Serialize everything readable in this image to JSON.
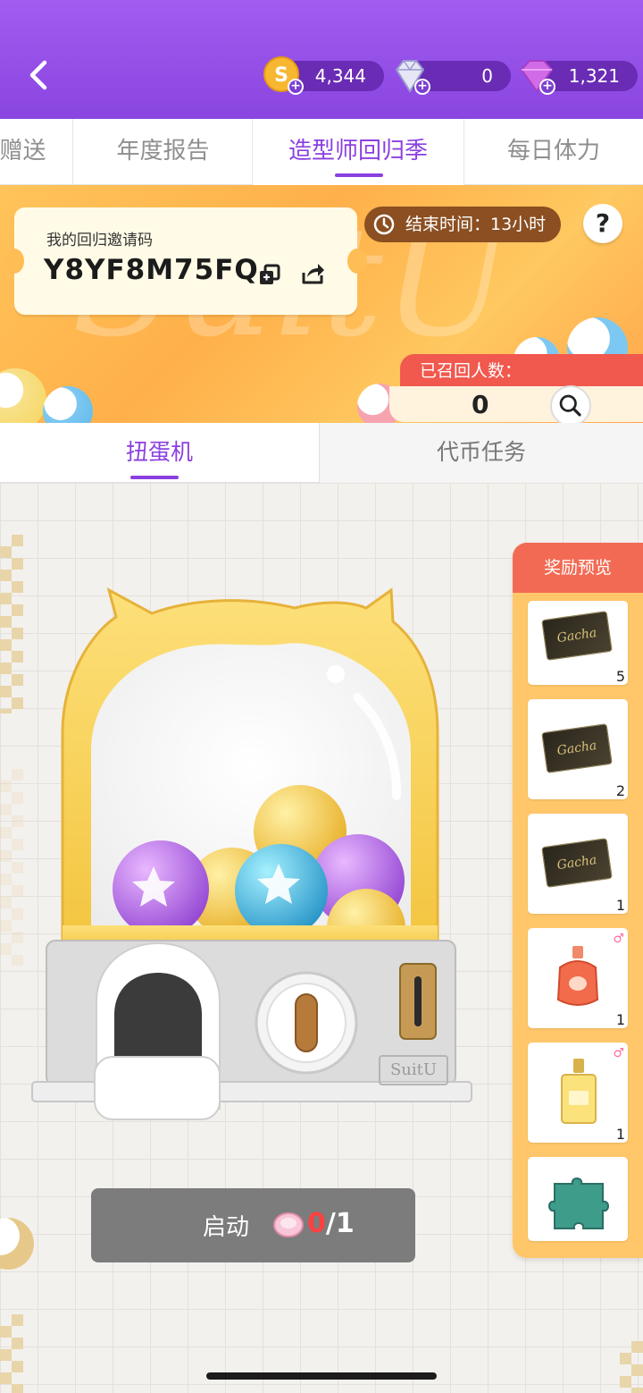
{
  "header": {
    "currencies": [
      {
        "name": "coin",
        "value": "4,344",
        "color": "#f5b731"
      },
      {
        "name": "diamond",
        "value": "0",
        "color": "#c9c9f0"
      },
      {
        "name": "gem",
        "value": "1,321",
        "color": "#d26be8"
      }
    ]
  },
  "tabs": [
    {
      "label": "赠送"
    },
    {
      "label": "年度报告"
    },
    {
      "label": "造型师回归季",
      "active": true
    },
    {
      "label": "每日体力"
    }
  ],
  "banner": {
    "invite_label": "我的回归邀请码",
    "invite_code": "Y8YF8M75FQ",
    "end_time": "结束时间：13小时",
    "help": "?",
    "recalled_label": "已召回人数：",
    "recalled_count": "0"
  },
  "subtabs": [
    {
      "label": "扭蛋机",
      "active": true
    },
    {
      "label": "代币任务"
    }
  ],
  "machine": {
    "brand": "SuitU",
    "slot_label": "SUITU"
  },
  "start": {
    "label": "启动",
    "count_current": "0",
    "count_total": "/1"
  },
  "rewards": {
    "title": "奖励预览",
    "items": [
      {
        "type": "gacha-ticket",
        "label": "Gacha",
        "qty": "5"
      },
      {
        "type": "gacha-ticket",
        "label": "Gacha",
        "qty": "2"
      },
      {
        "type": "gacha-ticket",
        "label": "Gacha",
        "qty": "1"
      },
      {
        "type": "perfume-orange",
        "qty": "1"
      },
      {
        "type": "perfume-yellow",
        "qty": "1"
      },
      {
        "type": "puzzle",
        "qty": ""
      }
    ]
  },
  "colors": {
    "accent": "#8b3fe0",
    "banner": "#ffb04a",
    "reward_title": "#f36a54",
    "start_zero": "#ff4040"
  }
}
